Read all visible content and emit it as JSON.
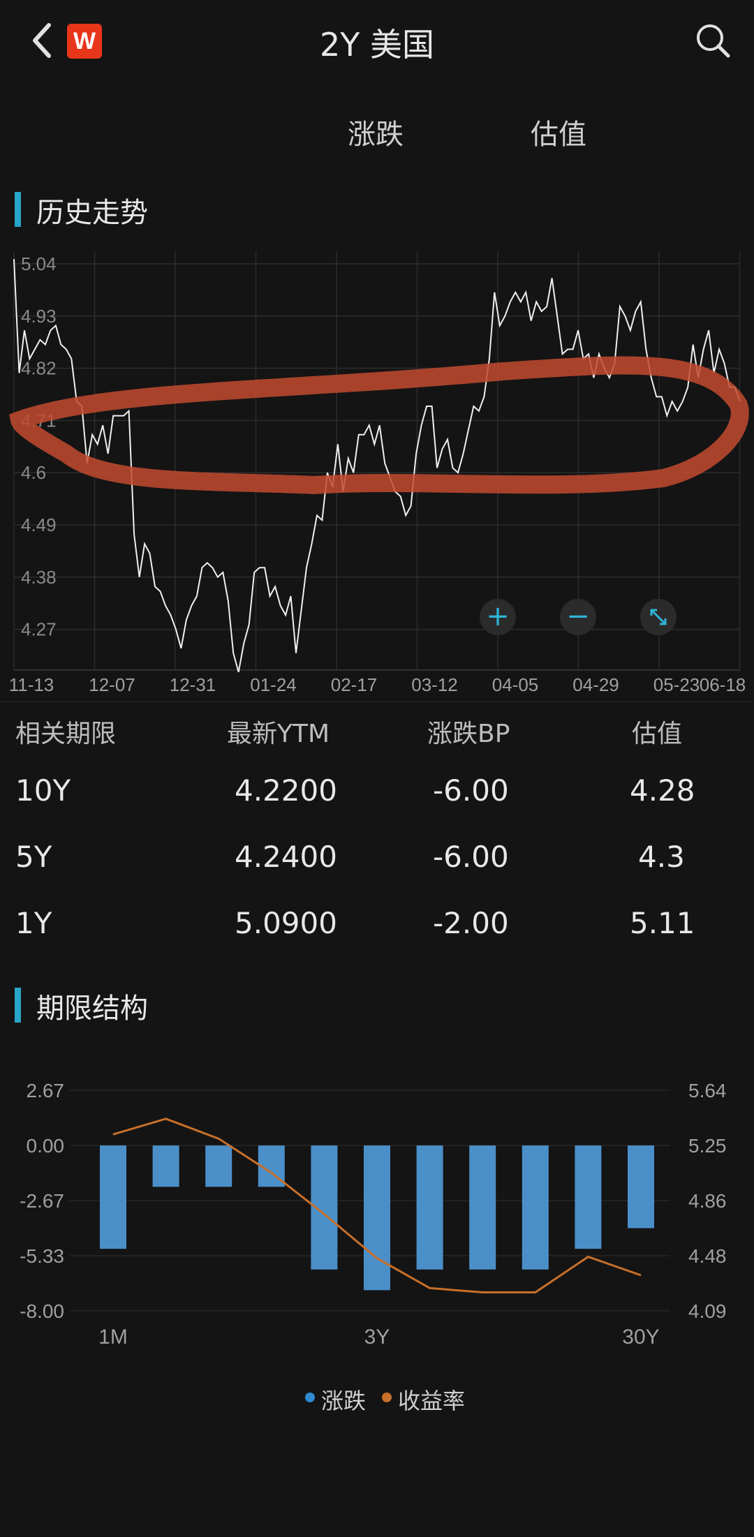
{
  "header": {
    "title": "2Y 美国",
    "logo_letter": "W"
  },
  "tabs": [
    {
      "label": "涨跌"
    },
    {
      "label": "估值"
    }
  ],
  "history": {
    "section_title": "历史走势",
    "chart_data": {
      "type": "line",
      "y_ticks": [
        "5.04",
        "4.93",
        "4.82",
        "4.71",
        "4.6",
        "4.49",
        "4.38",
        "4.27"
      ],
      "x_ticks": [
        "11-13",
        "12-07",
        "12-31",
        "01-24",
        "02-17",
        "03-12",
        "04-05",
        "04-29",
        "05-23",
        "06-18"
      ],
      "ylim": [
        4.18,
        5.06
      ],
      "values": [
        5.05,
        4.81,
        4.9,
        4.84,
        4.86,
        4.88,
        4.87,
        4.9,
        4.91,
        4.87,
        4.86,
        4.84,
        4.75,
        4.74,
        4.62,
        4.68,
        4.66,
        4.7,
        4.64,
        4.72,
        4.72,
        4.72,
        4.73,
        4.47,
        4.38,
        4.45,
        4.43,
        4.36,
        4.35,
        4.32,
        4.3,
        4.27,
        4.23,
        4.29,
        4.32,
        4.34,
        4.4,
        4.41,
        4.4,
        4.38,
        4.39,
        4.33,
        4.22,
        4.18,
        4.24,
        4.28,
        4.39,
        4.4,
        4.4,
        4.34,
        4.36,
        4.32,
        4.3,
        4.34,
        4.22,
        4.31,
        4.4,
        4.45,
        4.51,
        4.5,
        4.6,
        4.57,
        4.66,
        4.56,
        4.63,
        4.6,
        4.68,
        4.68,
        4.7,
        4.66,
        4.7,
        4.62,
        4.59,
        4.56,
        4.55,
        4.51,
        4.53,
        4.64,
        4.7,
        4.74,
        4.74,
        4.61,
        4.65,
        4.67,
        4.61,
        4.6,
        4.64,
        4.69,
        4.74,
        4.73,
        4.76,
        4.84,
        4.98,
        4.91,
        4.93,
        4.96,
        4.98,
        4.96,
        4.98,
        4.92,
        4.96,
        4.94,
        4.95,
        5.01,
        4.93,
        4.85,
        4.86,
        4.86,
        4.9,
        4.84,
        4.85,
        4.8,
        4.85,
        4.82,
        4.8,
        4.83,
        4.95,
        4.93,
        4.9,
        4.94,
        4.96,
        4.86,
        4.8,
        4.76,
        4.76,
        4.72,
        4.75,
        4.73,
        4.75,
        4.78,
        4.87,
        4.8,
        4.86,
        4.9,
        4.81,
        4.86,
        4.83,
        4.78,
        4.78,
        4.75
      ]
    },
    "controls": {
      "zoom_in": "+",
      "zoom_out": "−"
    }
  },
  "table": {
    "headers": [
      "相关期限",
      "最新YTM",
      "涨跌BP",
      "估值"
    ],
    "rows": [
      [
        "10Y",
        "4.2200",
        "-6.00",
        "4.28"
      ],
      [
        "5Y",
        "4.2400",
        "-6.00",
        "4.3"
      ],
      [
        "1Y",
        "5.0900",
        "-2.00",
        "5.11"
      ]
    ]
  },
  "term": {
    "section_title": "期限结构",
    "chart_data": {
      "type": "bar",
      "categories": [
        "1M",
        "",
        "",
        "",
        "",
        "3Y",
        "",
        "",
        "",
        "",
        "30Y"
      ],
      "x_tick_labels": [
        "1M",
        "3Y",
        "30Y"
      ],
      "left_axis_ticks": [
        "2.67",
        "0.00",
        "-2.67",
        "-5.33",
        "-8.00"
      ],
      "right_axis_ticks": [
        "5.64",
        "5.25",
        "4.86",
        "4.48",
        "4.09"
      ],
      "ylim_left": [
        -8.0,
        2.67
      ],
      "ylim_right": [
        4.09,
        5.64
      ],
      "series": [
        {
          "name": "涨跌",
          "type": "bar",
          "axis": "left",
          "color": "#4b8fc9",
          "values": [
            -5,
            -2,
            -2,
            -2,
            -6,
            -7,
            -6,
            -6,
            -6,
            -5,
            -4
          ]
        },
        {
          "name": "收益率",
          "type": "line",
          "axis": "right",
          "color": "#c8702a",
          "values": [
            5.33,
            5.44,
            5.3,
            5.06,
            4.77,
            4.46,
            4.25,
            4.22,
            4.22,
            4.47,
            4.34
          ]
        }
      ],
      "legend": "bottom"
    }
  },
  "colors": {
    "accent": "#28a5c9",
    "bar": "#4b8fc9",
    "yield_line": "#c8702a",
    "annotation_circle": "#c24a2f"
  }
}
